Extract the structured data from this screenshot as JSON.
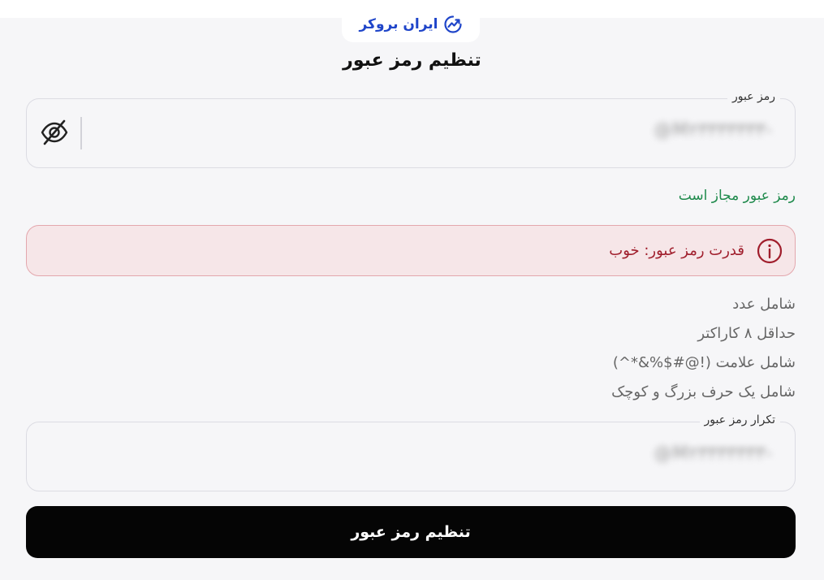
{
  "logo": {
    "text": "ایران بروکر",
    "icon": "trend-chart-icon",
    "color": "#1f45c9"
  },
  "page": {
    "title": "تنظیم رمز عبور"
  },
  "password_field": {
    "label": "رمز عبور",
    "value": "@M۲۳۳۳۳۳۳۳-",
    "toggle_icon": "eye-off-icon"
  },
  "validation": {
    "message": "رمز عبور مجاز است",
    "color": "#1f8a4c"
  },
  "strength": {
    "text": "قدرت رمز عبور: خوب",
    "icon": "info-circle-icon",
    "color": "#a01e2c"
  },
  "requirements": [
    "شامل عدد",
    "حداقل ۸ کاراکتر",
    "شامل علامت (!@#$%&*^)",
    "شامل یک حرف بزرگ و کوچک"
  ],
  "confirm_field": {
    "label": "تکرار رمز عبور",
    "value": "@M۲۳۳۳۳۳۳۳-"
  },
  "submit": {
    "label": "تنظیم رمز عبور"
  }
}
